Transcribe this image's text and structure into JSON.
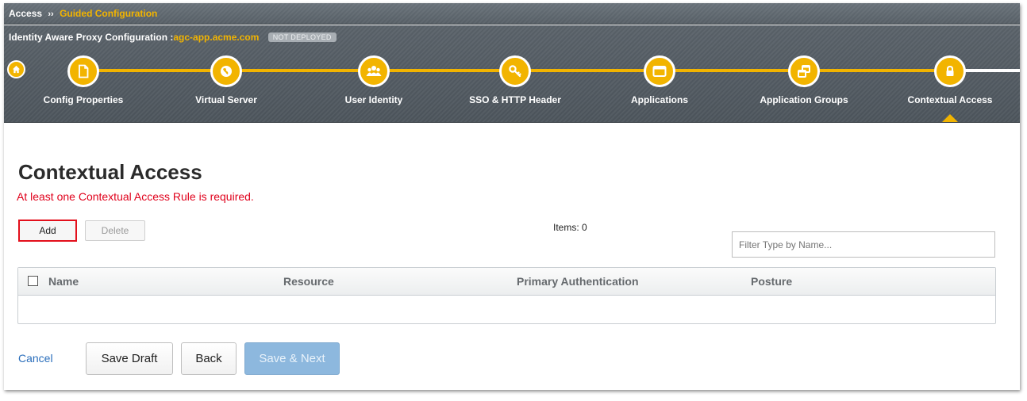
{
  "breadcrumb": {
    "root": "Access",
    "separator": "››",
    "current": "Guided Configuration"
  },
  "config": {
    "label": "Identity Aware Proxy Configuration :",
    "host": "agc-app.acme.com",
    "status": "NOT DEPLOYED"
  },
  "steps": [
    {
      "label": "Config Properties",
      "icon": "document-icon"
    },
    {
      "label": "Virtual Server",
      "icon": "globe-icon"
    },
    {
      "label": "User Identity",
      "icon": "users-icon"
    },
    {
      "label": "SSO & HTTP Header",
      "icon": "key-icon"
    },
    {
      "label": "Applications",
      "icon": "window-icon"
    },
    {
      "label": "Application Groups",
      "icon": "windows-stack-icon"
    },
    {
      "label": "Contextual Access",
      "icon": "lock-icon",
      "active": true
    }
  ],
  "page": {
    "title": "Contextual Access",
    "warning": "At least one Contextual Access Rule is required."
  },
  "toolbar": {
    "add": "Add",
    "delete": "Delete",
    "items": "Items: 0"
  },
  "filter": {
    "placeholder": "Filter Type by Name..."
  },
  "table": {
    "columns": [
      "Name",
      "Resource",
      "Primary Authentication",
      "Posture"
    ]
  },
  "actions": {
    "cancel": "Cancel",
    "save_draft": "Save Draft",
    "back": "Back",
    "save_next": "Save & Next"
  },
  "colors": {
    "accent": "#f2b400",
    "error": "#e0001b",
    "link": "#2a6ebb",
    "primary_disabled": "#8db8de"
  }
}
